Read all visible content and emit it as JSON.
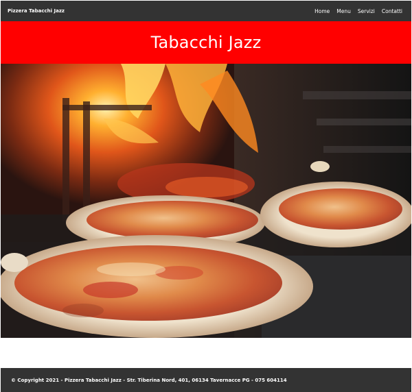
{
  "navbar": {
    "brand": "Pizzera Tabacchi Jazz",
    "links": [
      "Home",
      "Menu",
      "Servizi",
      "Contatti"
    ]
  },
  "hero": {
    "title": "Tabacchi Jazz"
  },
  "footer": {
    "copyright": "© Copyright 2021 - Pizzera Tabacchi Jazz - Str. Tiberina Nord, 401, 06134 Tavernacce PG - 075 604114"
  },
  "colors": {
    "navbar_bg": "#333333",
    "hero_bg": "#ff0000",
    "text": "#ffffff"
  }
}
